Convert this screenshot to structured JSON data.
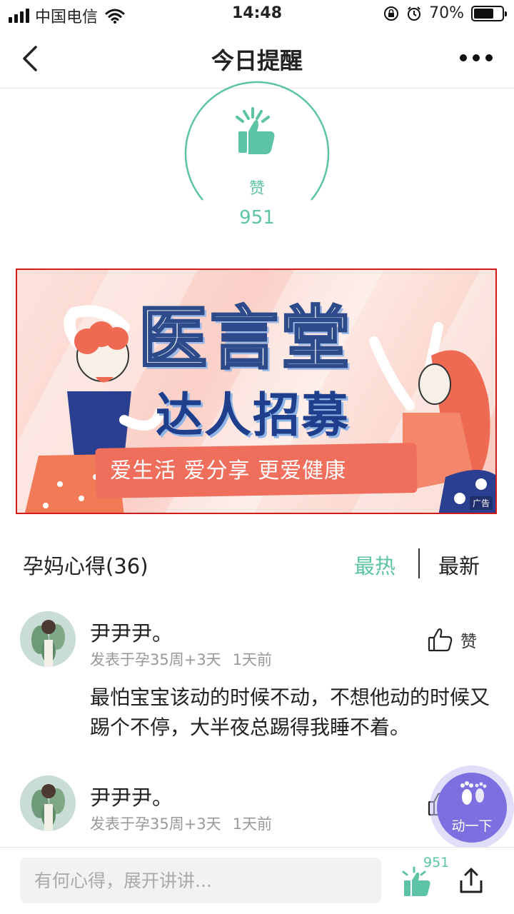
{
  "status_bar": {
    "carrier": "中国电信",
    "time": "14:48",
    "battery": "70%",
    "battery_level": 0.7
  },
  "nav": {
    "title": "今日提醒"
  },
  "like_panel": {
    "label": "赞",
    "count": "951"
  },
  "banner": {
    "title": "医言堂",
    "subtitle": "达人招募",
    "tagline": "爱生活  爱分享  更爱健康",
    "ad_badge": "广告"
  },
  "section": {
    "title": "孕妈心得(36)",
    "tab_hot": "最热",
    "tab_new": "最新"
  },
  "comments": [
    {
      "name": "尹尹尹。",
      "meta_stage": "发表于孕35周+3天",
      "meta_time": "1天前",
      "like_label": "赞",
      "body": "最怕宝宝该动的时候不动，不想他动的时候又踢个不停，大半夜总踢得我睡不着。"
    },
    {
      "name": "尹尹尹。",
      "meta_stage": "发表于孕35周+3天",
      "meta_time": "1天前",
      "like_label": "赞"
    }
  ],
  "float_button": {
    "label": "动一下"
  },
  "bottom_bar": {
    "input_placeholder": "有何心得，展开讲讲...",
    "like_count": "951"
  },
  "colors": {
    "accent": "#5cc4a4",
    "float_button": "#7c6fe0",
    "banner_border": "#d21c1c"
  },
  "icons": [
    "signal-icon",
    "wifi-icon",
    "orientation-lock-icon",
    "alarm-icon",
    "battery-icon",
    "back-icon",
    "more-icon",
    "thumbs-up-icon",
    "footprint-icon",
    "share-icon"
  ]
}
